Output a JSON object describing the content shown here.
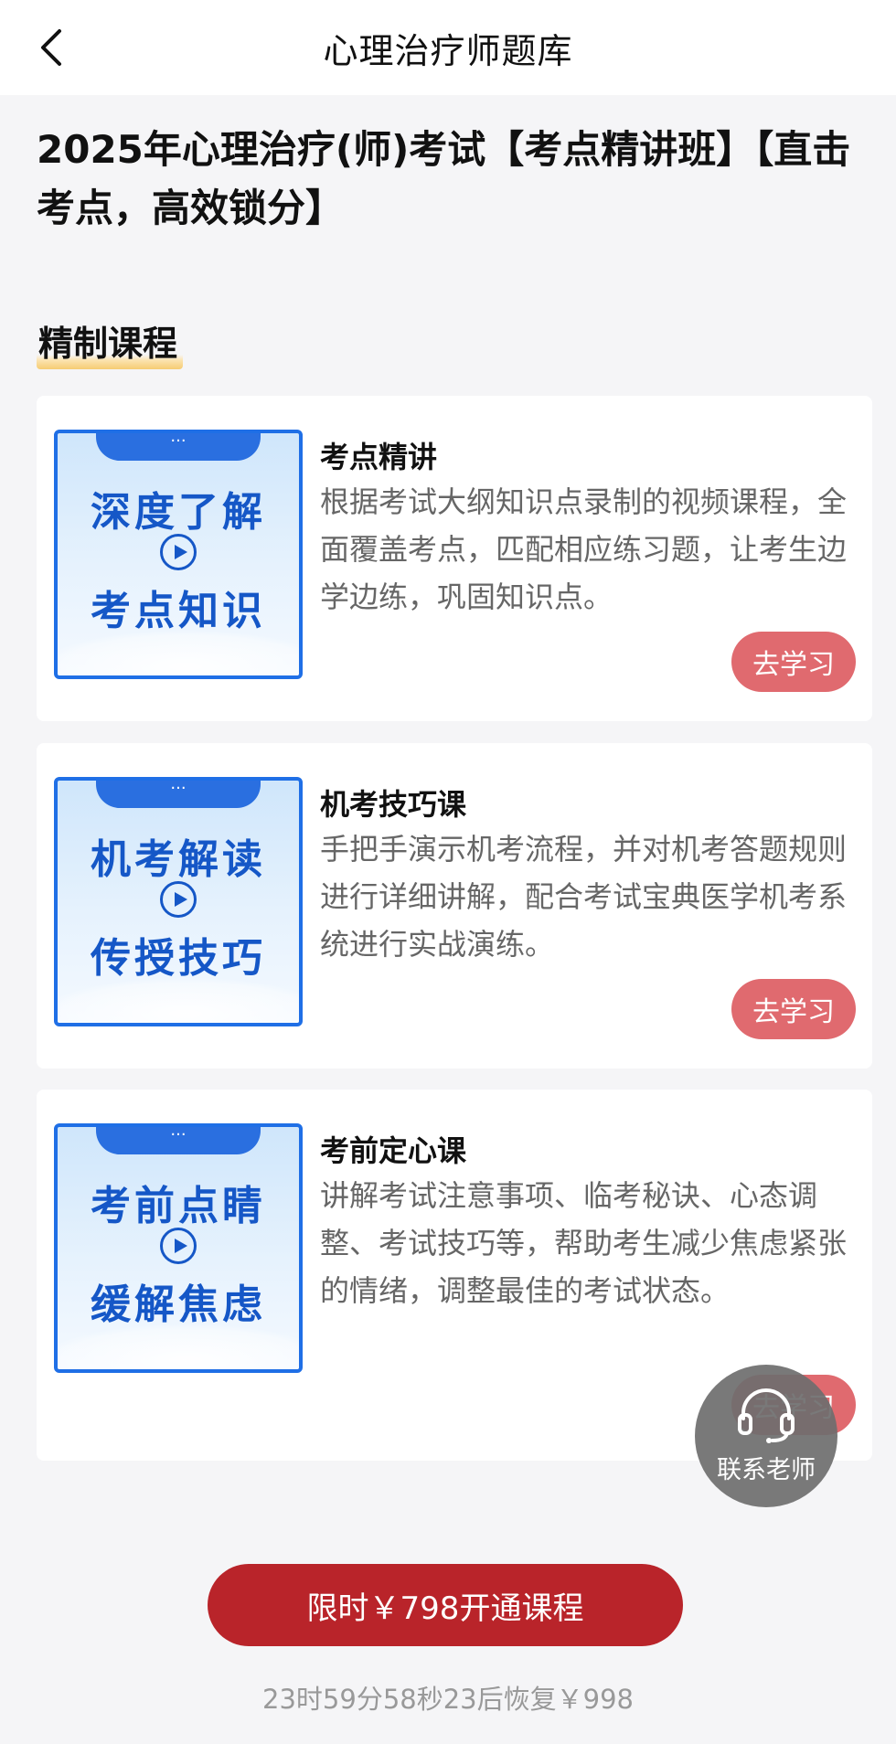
{
  "nav": {
    "title": "心理治疗师题库"
  },
  "page_title": "2025年心理治疗(师)考试【考点精讲班】【直击考点，高效锁分】",
  "section": {
    "title": "精制课程"
  },
  "courses": [
    {
      "thumb_line1": "深度了解",
      "thumb_line2": "考点知识",
      "thumb_tab": "···",
      "name": "考点精讲",
      "desc": "根据考试大纲知识点录制的视频课程，全面覆盖考点，匹配相应练习题，让考生边学边练，巩固知识点。",
      "button": "去学习"
    },
    {
      "thumb_line1": "机考解读",
      "thumb_line2": "传授技巧",
      "thumb_tab": "···",
      "name": "机考技巧课",
      "desc": "手把手演示机考流程，并对机考答题规则进行详细讲解，配合考试宝典医学机考系统进行实战演练。",
      "button": "去学习"
    },
    {
      "thumb_line1": "考前点睛",
      "thumb_line2": "缓解焦虑",
      "thumb_tab": "···",
      "name": "考前定心课",
      "desc": "讲解考试注意事项、临考秘诀、心态调整、考试技巧等，帮助考生减少焦虑紧张的情绪，调整最佳的考试状态。",
      "button": "去学习"
    }
  ],
  "contact": {
    "label": "联系老师",
    "icon": "headset-icon"
  },
  "buy_button": "限时￥798开通课程",
  "countdown": "23时59分58秒23后恢复￥998",
  "colors": {
    "brand_red": "#b9242a",
    "study_button": "#e06a6f",
    "thumb_blue": "#1f6fe6"
  }
}
